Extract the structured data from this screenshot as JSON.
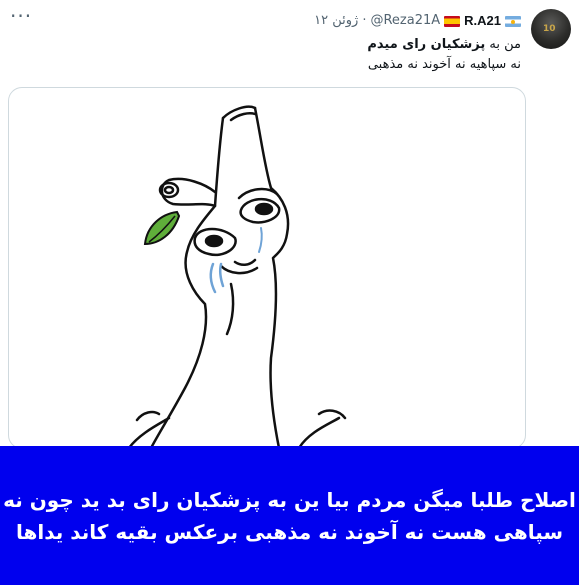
{
  "tweet": {
    "display_name": "R.A21",
    "handle": "@Reza21A",
    "separator": "·",
    "time": "۱۲ ژوئن",
    "more_label": "···",
    "line1_prefix": "من به",
    "line1_bold": "پزشکیان رای میدم",
    "line2": "نه سپاهیه نه آخوند نه مذهبی",
    "flags": [
      "spain-flag",
      "argentina-flag"
    ],
    "avatar_text": "10"
  },
  "media": {
    "image": "meme-sad-wojak-tree-stump-drawing"
  },
  "caption": {
    "line1": "اصلاح طلبا میگن مردم بیا ین به پزشکیان رای بد ید چون نه",
    "line2": "سپاهی هست نه آخوند نه مذهبی برعکس بقیه کاند یداها",
    "background_color": "#0000ee",
    "text_color": "#ffffff"
  }
}
